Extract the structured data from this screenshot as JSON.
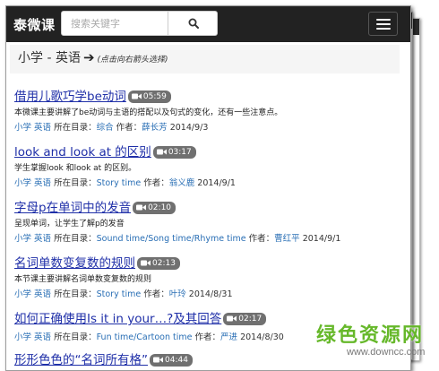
{
  "navbar": {
    "brand": "泰微课",
    "search_placeholder": "搜索关键字",
    "search_icon": "search-icon",
    "menu_icon": "hamburger-menu-icon"
  },
  "header": {
    "crumb": "小学 - 英语",
    "arrow": "➔",
    "hint": "(点击向右箭头选择)"
  },
  "items": [
    {
      "title": "借用儿歌巧学be动词",
      "duration": "05:59",
      "desc": "本微课主要讲解了be动词与主语的搭配以及句式的变化，还有一些注意点。",
      "grade": "小学",
      "subject": "英语",
      "dir_label": "所在目录：",
      "dir": "综合",
      "author_label": "作者：",
      "author": "薛长芳",
      "date": "2014/9/3"
    },
    {
      "title": "look and look at 的区别",
      "duration": "03:17",
      "desc": "学生掌握look 和look at 的区别。",
      "grade": "小学",
      "subject": "英语",
      "dir_label": "所在目录：",
      "dir": "Story time",
      "author_label": "作者：",
      "author": "翁义鹿",
      "date": "2014/9/1"
    },
    {
      "title": "字母p在单词中的发音",
      "duration": "02:10",
      "desc": "呈现单词，让学生了解p的发音",
      "grade": "小学",
      "subject": "英语",
      "dir_label": "所在目录：",
      "dir": "Sound time/Song time/Rhyme time",
      "author_label": "作者：",
      "author": "曹红平",
      "date": "2014/9/1"
    },
    {
      "title": "名词单数变复数的规则",
      "duration": "02:13",
      "desc": "本节课主要讲解名词单数变复数的规则",
      "grade": "小学",
      "subject": "英语",
      "dir_label": "所在目录：",
      "dir": "Story time",
      "author_label": "作者：",
      "author": "叶玲",
      "date": "2014/8/31"
    },
    {
      "title": "如何正确使用Is it in your…?及其回答",
      "duration": "02:17",
      "desc": "",
      "grade": "小学",
      "subject": "英语",
      "dir_label": "所在目录：",
      "dir": "Fun time/Cartoon time",
      "author_label": "作者：",
      "author": "严进",
      "date": "2014/8/30"
    },
    {
      "title": "形形色色的“名词所有格”",
      "duration": "04:44"
    }
  ],
  "watermark": {
    "text": "绿色资源网",
    "url": "www.downcc.com"
  },
  "colors": {
    "navbar_bg": "#222222",
    "link_title": "#1f2fa8",
    "link_meta": "#2a6fb5",
    "badge_bg": "#707070",
    "watermark": "#66b82a"
  }
}
